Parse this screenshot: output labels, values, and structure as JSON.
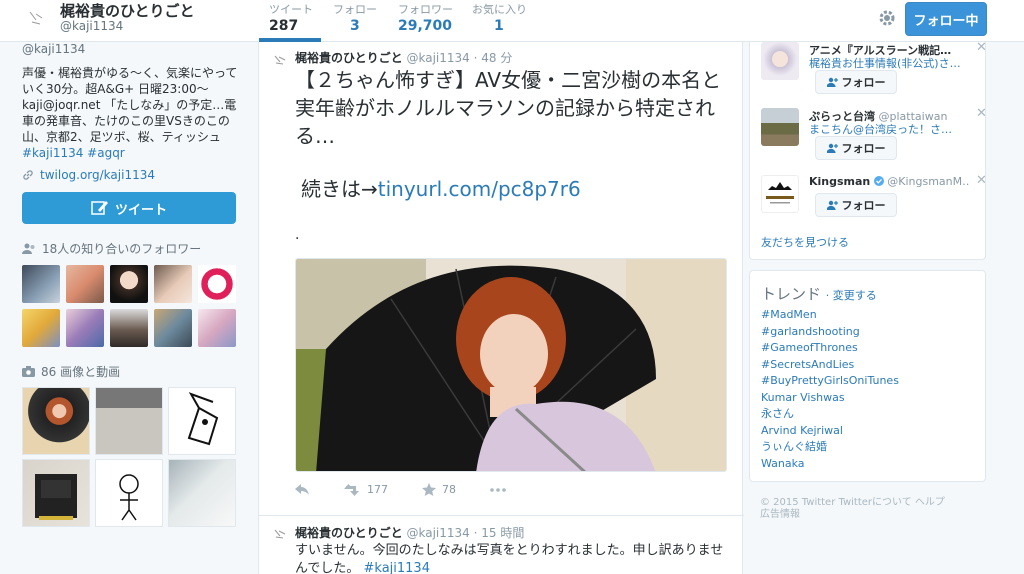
{
  "header": {
    "profile_name": "梶裕貴のひとりごと",
    "profile_handle": "@kaji1134",
    "stats": [
      {
        "label": "ツイート",
        "value": "287"
      },
      {
        "label": "フォロー",
        "value": "3"
      },
      {
        "label": "フォロワー",
        "value": "29,700"
      },
      {
        "label": "お気に入り",
        "value": "1"
      }
    ],
    "follow_button": "フォロー中"
  },
  "profile": {
    "handle": "@kaji1134",
    "bio": "声優・梶裕貴がゆる〜く、気楽にやっていく30分。超A&G+ 日曜23:00〜kaji@joqr.net 「たしなみ」の予定…電車の発車音、たけのこの里VSきのこの山、京都2、足ツボ、桜、ティッシュ",
    "bio_tags": "#kaji1134 #agqr",
    "link": "twilog.org/kaji1134",
    "tweet_button": "ツイート",
    "followers_known": "18人の知り合いのフォロワー",
    "media": "86 画像と動画"
  },
  "tweets": [
    {
      "name": "梶裕貴のひとりごと",
      "handle": "@kaji1134",
      "time": "· 48 分",
      "text": "【２ちゃん怖すぎ】AV女優・二宮沙樹の本名と実年齢がホノルルマラソンの記録から特定される…",
      "link_prefix": "続きは→",
      "link": "tinyurl.com/pc8p7r6",
      "dot": ".",
      "retweets": "177",
      "favorites": "78"
    },
    {
      "name": "梶裕貴のひとりごと",
      "handle": "@kaji1134",
      "time": "· 15 時間",
      "text": "すいません。今回のたしなみは写真をとりわすれました。申し訳ありませんでした。",
      "tag": "#kaji1134"
    }
  ],
  "who_to_follow": [
    {
      "name": "アニメ『アルスラーン戦記…",
      "handle": "",
      "sub": "梶裕貴お仕事情報(非公式)さ…",
      "button": "フォロー"
    },
    {
      "name": "ぷらっと台湾",
      "handle": "@plattaiwan",
      "sub": "まこちん@台湾戻った！さ…",
      "button": "フォロー"
    },
    {
      "name": "Kingsman",
      "handle": "@KingsmanM…",
      "sub": "",
      "button": "フォロー"
    }
  ],
  "find_friends": "友だちを見つける",
  "trends": {
    "title": "トレンド",
    "change": "· 変更する",
    "items": [
      "#MadMen",
      "#garlandshooting",
      "#GameofThrones",
      "#SecretsAndLies",
      "#BuyPrettyGirlsOniTunes",
      "Kumar Vishwas",
      "永さん",
      "Arvind Kejriwal",
      "うぃんぐ結婚",
      "Wanaka"
    ]
  },
  "footer": {
    "line1": "© 2015 Twitter  Twitterについて  ヘルプ",
    "line2": "広告情報"
  },
  "colors": {
    "accent": "#2b7bb9",
    "button": "#3b94d9",
    "background": "#f5f8fa"
  }
}
